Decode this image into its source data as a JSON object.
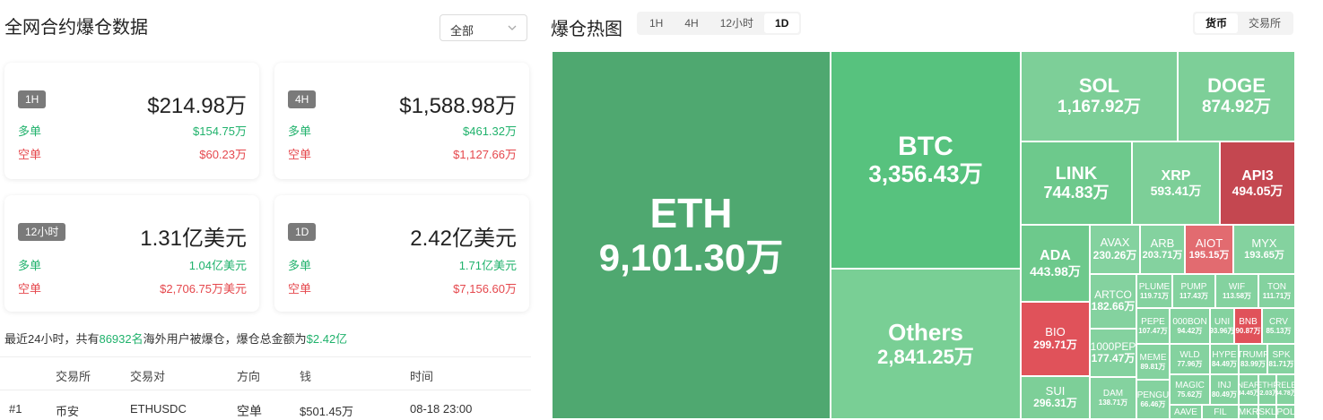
{
  "left": {
    "title": "全网合约爆仓数据",
    "filter": "全部",
    "cards": [
      {
        "period": "1H",
        "total": "$214.98万",
        "long_label": "多单",
        "long_value": "$154.75万",
        "short_label": "空单",
        "short_value": "$60.23万"
      },
      {
        "period": "4H",
        "total": "$1,588.98万",
        "long_label": "多单",
        "long_value": "$461.32万",
        "short_label": "空单",
        "short_value": "$1,127.66万"
      },
      {
        "period": "12小时",
        "total": "1.31亿美元",
        "long_label": "多单",
        "long_value": "1.04亿美元",
        "short_label": "空单",
        "short_value": "$2,706.75万美元"
      },
      {
        "period": "1D",
        "total": "2.42亿美元",
        "long_label": "多单",
        "long_value": "1.71亿美元",
        "short_label": "空单",
        "short_value": "$7,156.60万"
      }
    ],
    "summary": {
      "p1": "最近24小时，共有",
      "count": "86932名",
      "p2": "海外用户被爆仓，爆仓总金额为",
      "amount": "$2.42亿"
    },
    "table": {
      "headers": [
        "交易所",
        "交易对",
        "方向",
        "钱",
        "时间"
      ],
      "rows": [
        {
          "rank": "#1",
          "exchange": "币安",
          "pair": "ETHUSDC",
          "side": "空单",
          "amount": "$501.45万",
          "time": "08-18 23:00"
        }
      ]
    }
  },
  "right": {
    "title": "爆仓热图",
    "periods": [
      "1H",
      "4H",
      "12小时",
      "1D"
    ],
    "active_period": "1D",
    "modes": [
      "货币",
      "交易所"
    ],
    "active_mode": "货币"
  },
  "colors": {
    "green": "#20b26c",
    "red": "#e5484d",
    "badge": "#7a7a7a"
  },
  "heatmap": {
    "items": [
      {
        "name": "ETH",
        "value": "9,101.30万",
        "fill": "#4fa870"
      },
      {
        "name": "BTC",
        "value": "3,356.43万",
        "fill": "#57c27e"
      },
      {
        "name": "Others",
        "value": "2,841.25万",
        "fill": "#79cf95"
      },
      {
        "name": "SOL",
        "value": "1,167.92万",
        "fill": "#7dcf98"
      },
      {
        "name": "DOGE",
        "value": "874.92万",
        "fill": "#7dcf98"
      },
      {
        "name": "LINK",
        "value": "744.83万",
        "fill": "#6dc98c"
      },
      {
        "name": "XRP",
        "value": "593.41万",
        "fill": "#7dcf98"
      },
      {
        "name": "API3",
        "value": "494.05万",
        "fill": "#c44750"
      },
      {
        "name": "ADA",
        "value": "443.98万",
        "fill": "#6dc98c"
      },
      {
        "name": "AVAX",
        "value": "230.26万",
        "fill": "#84d29f"
      },
      {
        "name": "ARB",
        "value": "203.71万",
        "fill": "#84d29f"
      },
      {
        "name": "AIOT",
        "value": "195.15万",
        "fill": "#e26b70"
      },
      {
        "name": "MYX",
        "value": "193.65万",
        "fill": "#84d29f"
      },
      {
        "name": "BIO",
        "value": "299.71万",
        "fill": "#e0525a"
      },
      {
        "name": "SUI",
        "value": "296.31万",
        "fill": "#7dcf98"
      },
      {
        "name": "ARTCO",
        "value": "182.66万",
        "fill": "#84d29f"
      },
      {
        "name": "PLUME",
        "value": "119.71万",
        "fill": "#84d29f"
      },
      {
        "name": "PUMP",
        "value": "117.43万",
        "fill": "#84d29f"
      },
      {
        "name": "WIF",
        "value": "113.58万",
        "fill": "#84d29f"
      },
      {
        "name": "TON",
        "value": "111.71万",
        "fill": "#84d29f"
      },
      {
        "name": "1000PEP",
        "value": "177.47万",
        "fill": "#84d29f"
      },
      {
        "name": "PEPE",
        "value": "107.47万",
        "fill": "#84d29f"
      },
      {
        "name": "000BON",
        "value": "94.42万",
        "fill": "#84d29f"
      },
      {
        "name": "UNI",
        "value": "93.96万",
        "fill": "#84d29f"
      },
      {
        "name": "BNB",
        "value": "90.87万",
        "fill": "#e0525a"
      },
      {
        "name": "CRV",
        "value": "85.13万",
        "fill": "#84d29f"
      },
      {
        "name": "MEME",
        "value": "89.81万",
        "fill": "#84d29f"
      },
      {
        "name": "WLD",
        "value": "77.96万",
        "fill": "#84d29f"
      },
      {
        "name": "HYPE",
        "value": "84.49万",
        "fill": "#84d29f"
      },
      {
        "name": "TRUMP",
        "value": "83.99万",
        "fill": "#84d29f"
      },
      {
        "name": "SPK",
        "value": "81.71万",
        "fill": "#84d29f"
      },
      {
        "name": "DAM",
        "value": "138.71万",
        "fill": "#84d29f"
      },
      {
        "name": "MAGIC",
        "value": "75.62万",
        "fill": "#84d29f"
      },
      {
        "name": "INJ",
        "value": "80.49万",
        "fill": "#84d29f"
      },
      {
        "name": "NEAR",
        "value": "84.45万",
        "fill": "#84d29f"
      },
      {
        "name": "ETHF",
        "value": "82.03万",
        "fill": "#84d29f"
      },
      {
        "name": "RELE",
        "value": "84.78万",
        "fill": "#84d29f"
      },
      {
        "name": "PENGU",
        "value": "66.46万",
        "fill": "#84d29f"
      },
      {
        "name": "AAVE",
        "value": "",
        "fill": "#84d29f"
      },
      {
        "name": "FIL",
        "value": "",
        "fill": "#84d29f"
      },
      {
        "name": "MKR",
        "value": "",
        "fill": "#84d29f"
      },
      {
        "name": "SKL",
        "value": "",
        "fill": "#84d29f"
      },
      {
        "name": "POL",
        "value": "",
        "fill": "#84d29f"
      }
    ]
  }
}
